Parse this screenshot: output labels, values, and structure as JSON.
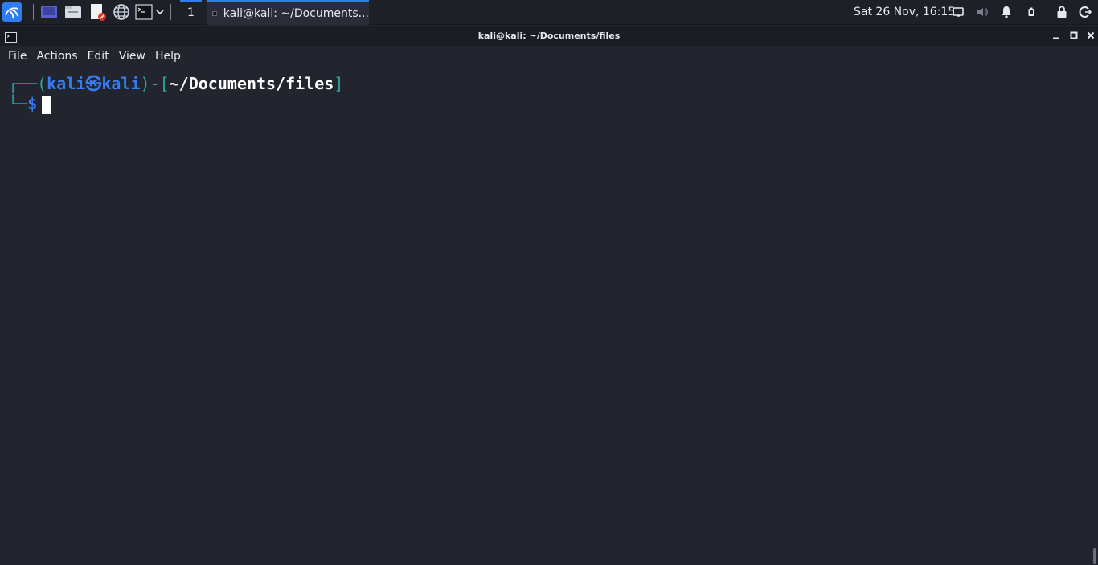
{
  "panel": {
    "launchers": [
      {
        "name": "kali-menu-icon"
      },
      {
        "name": "show-desktop-icon"
      },
      {
        "name": "file-manager-icon"
      },
      {
        "name": "text-editor-icon"
      },
      {
        "name": "web-browser-icon"
      },
      {
        "name": "terminal-launcher-icon"
      }
    ],
    "workspace": "1",
    "task_title": "kali@kali: ~/Documents...",
    "clock": "Sat 26 Nov, 16:15"
  },
  "window": {
    "title": "kali@kali: ~/Documents/files"
  },
  "menu": {
    "items": [
      "File",
      "Actions",
      "Edit",
      "View",
      "Help"
    ]
  },
  "terminal": {
    "prompt_open": "┌──(",
    "user": "kali",
    "at_symbol": "㉿",
    "host": "kali",
    "prompt_mid": ")-[",
    "path": "~/Documents/files",
    "prompt_close": "]",
    "prompt_line2": "└─",
    "dollar": "$"
  },
  "colors": {
    "accent": "#2f7df1",
    "prompt_teal": "#2fa3a3",
    "prompt_blue": "#367bf0",
    "background": "#23252e"
  }
}
